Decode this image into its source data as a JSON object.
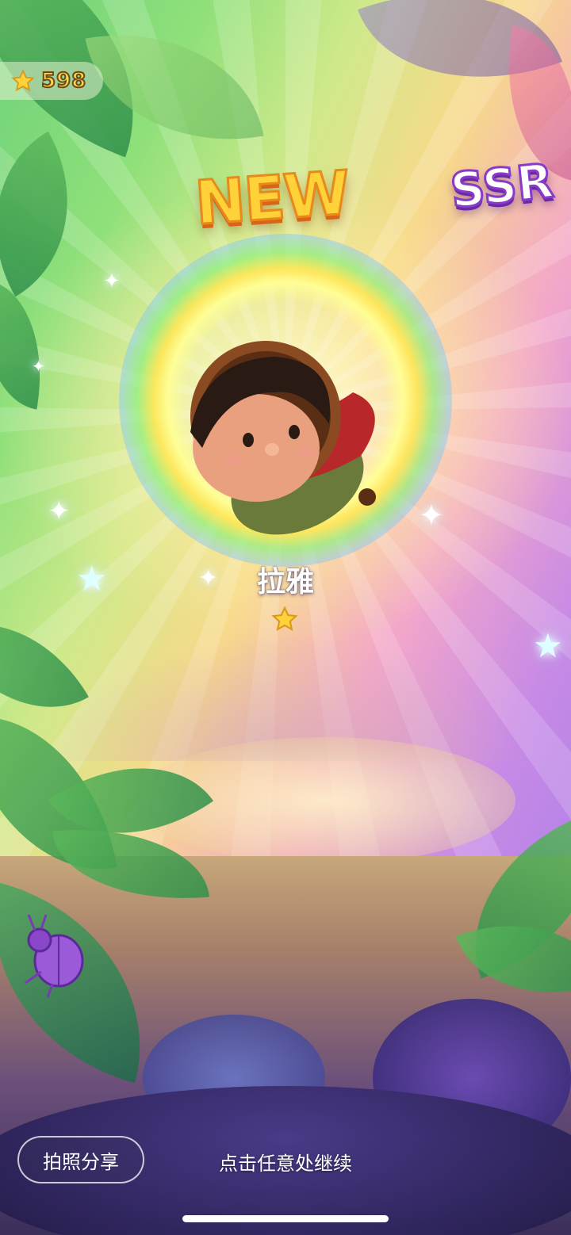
{
  "hud": {
    "coins": "598",
    "coin_icon": "star-icon"
  },
  "banner": {
    "new_label": "NEW",
    "rarity_label": "SSR"
  },
  "character": {
    "name": "拉雅",
    "stars": 1
  },
  "footer": {
    "share_label": "拍照分享",
    "continue_hint": "点击任意处继续"
  },
  "colors": {
    "accent_gold": "#ffd23a",
    "ssr_purple": "#8a3ac8"
  }
}
